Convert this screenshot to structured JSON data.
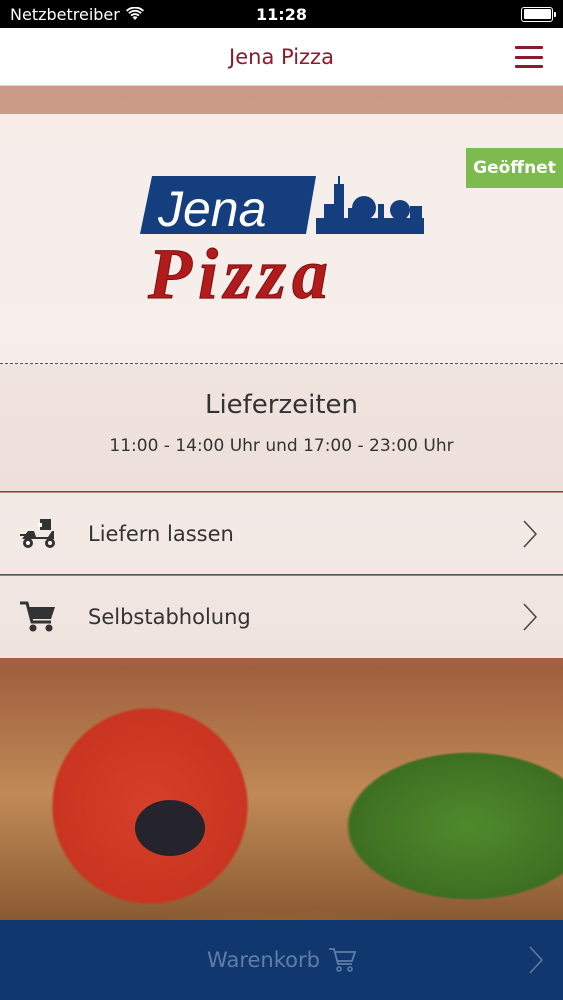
{
  "status_bar": {
    "carrier": "Netzbetreiber",
    "time": "11:28"
  },
  "nav": {
    "title": "Jena Pizza"
  },
  "logo": {
    "line1": "Jena",
    "line2": "Pizza",
    "colors": {
      "blue": "#153e7e",
      "red": "#b21b1b"
    }
  },
  "status_badge": "Geöffnet",
  "delivery_times": {
    "heading": "Lieferzeiten",
    "value": "11:00 - 14:00 Uhr und 17:00 - 23:00 Uhr"
  },
  "options": [
    {
      "label": "Liefern lassen",
      "icon": "delivery-scooter-icon"
    },
    {
      "label": "Selbstabholung",
      "icon": "shopping-cart-icon"
    }
  ],
  "cart": {
    "label": "Warenkorb",
    "icon": "shopping-cart-icon"
  },
  "colors": {
    "brand_red": "#8b1a2b",
    "open_green": "#7dbb4f",
    "cart_blue": "#10386e"
  }
}
